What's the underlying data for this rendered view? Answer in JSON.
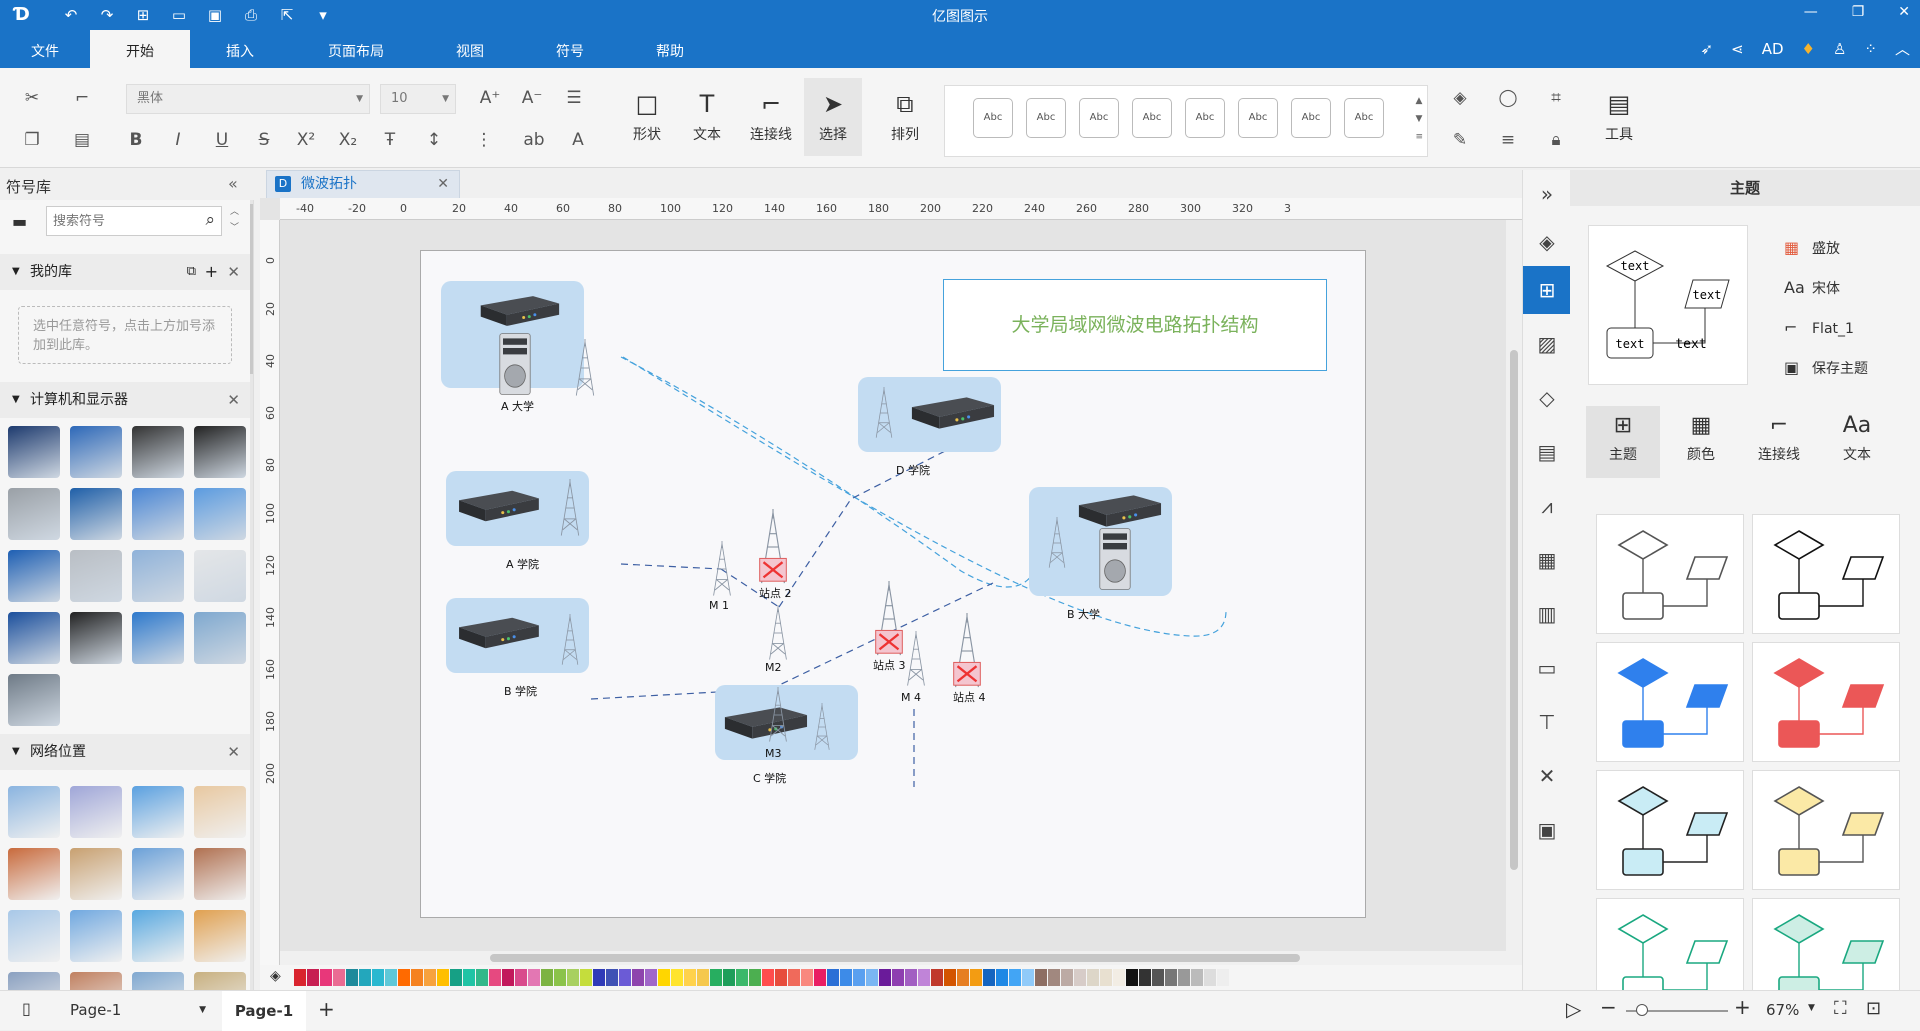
{
  "app": {
    "title": "亿图图示"
  },
  "menu": {
    "tabs": [
      "文件",
      "开始",
      "插入",
      "页面布局",
      "视图",
      "符号",
      "帮助"
    ],
    "active": 1,
    "user": "AD"
  },
  "ribbon": {
    "font_name": "黑体",
    "font_size": "10",
    "big_buttons": [
      {
        "label": "形状",
        "icon": "square-icon"
      },
      {
        "label": "文本",
        "icon": "text-icon"
      },
      {
        "label": "连接线",
        "icon": "connector-icon"
      },
      {
        "label": "选择",
        "icon": "pointer-icon"
      },
      {
        "label": "排列",
        "icon": "arrange-icon"
      },
      {
        "label": "工具",
        "icon": "tools-icon"
      }
    ],
    "style_gallery": [
      "Abc",
      "Abc",
      "Abc",
      "Abc",
      "Abc",
      "Abc",
      "Abc",
      "Abc"
    ]
  },
  "left": {
    "title": "符号库",
    "search_placeholder": "搜索符号",
    "my_library": {
      "title": "我的库",
      "hint": "选中任意符号，点击上方加号添加到此库。"
    },
    "sections": [
      {
        "title": "计算机和显示器"
      },
      {
        "title": "网络位置"
      }
    ]
  },
  "doc": {
    "tab": "微波拓扑"
  },
  "ruler": {
    "h": [
      "-40",
      "-20",
      "0",
      "20",
      "40",
      "60",
      "80",
      "100",
      "120",
      "140",
      "160",
      "180",
      "200",
      "220",
      "240",
      "260",
      "280",
      "300",
      "320",
      "3"
    ],
    "v": [
      "0",
      "20",
      "40",
      "60",
      "80",
      "100",
      "120",
      "140",
      "160",
      "180",
      "200"
    ]
  },
  "diagram": {
    "title": "大学局域网微波电路拓扑结构",
    "labels": {
      "a_univ": "A 大学",
      "a_coll": "A 学院",
      "b_coll": "B 学院",
      "c_coll": "C 学院",
      "d_coll": "D 学院",
      "b_univ": "B 大学",
      "m1": "M 1",
      "m2": "M2",
      "m3": "M3",
      "m4": "M 4",
      "s2": "站点 2",
      "s3": "站点 3",
      "s4": "站点 4"
    }
  },
  "right": {
    "title": "主题",
    "preview_texts": [
      "text",
      "text",
      "text",
      "text"
    ],
    "options": [
      {
        "label": "盛放",
        "icon": "grid-color-icon"
      },
      {
        "label": "宋体",
        "icon": "font-icon"
      },
      {
        "label": "Flat_1",
        "icon": "connector-icon"
      },
      {
        "label": "保存主题",
        "icon": "save-icon"
      }
    ],
    "tabs": [
      {
        "label": "主题",
        "icon": "theme-icon"
      },
      {
        "label": "颜色",
        "icon": "color-grid-icon"
      },
      {
        "label": "连接线",
        "icon": "connector-icon"
      },
      {
        "label": "文本",
        "icon": "font-icon"
      }
    ],
    "themes": [
      {
        "fill": "#ffffff",
        "stroke": "#555555"
      },
      {
        "fill": "#ffffff",
        "stroke": "#111111"
      },
      {
        "fill": "#2f80ed",
        "stroke": "#2f80ed"
      },
      {
        "fill": "#eb5757",
        "stroke": "#eb5757"
      },
      {
        "fill": "#c9ecf5",
        "stroke": "#222222"
      },
      {
        "fill": "#fbe9a6",
        "stroke": "#555555"
      },
      {
        "fill": "#ffffff",
        "stroke": "#1aa880"
      },
      {
        "fill": "#cdeee4",
        "stroke": "#1aa880"
      }
    ]
  },
  "status": {
    "page_select": "Page-1",
    "page_tab": "Page-1",
    "zoom": "67%"
  },
  "colors": {
    "accent": "#1a73c7",
    "link": "#45a2dc"
  }
}
